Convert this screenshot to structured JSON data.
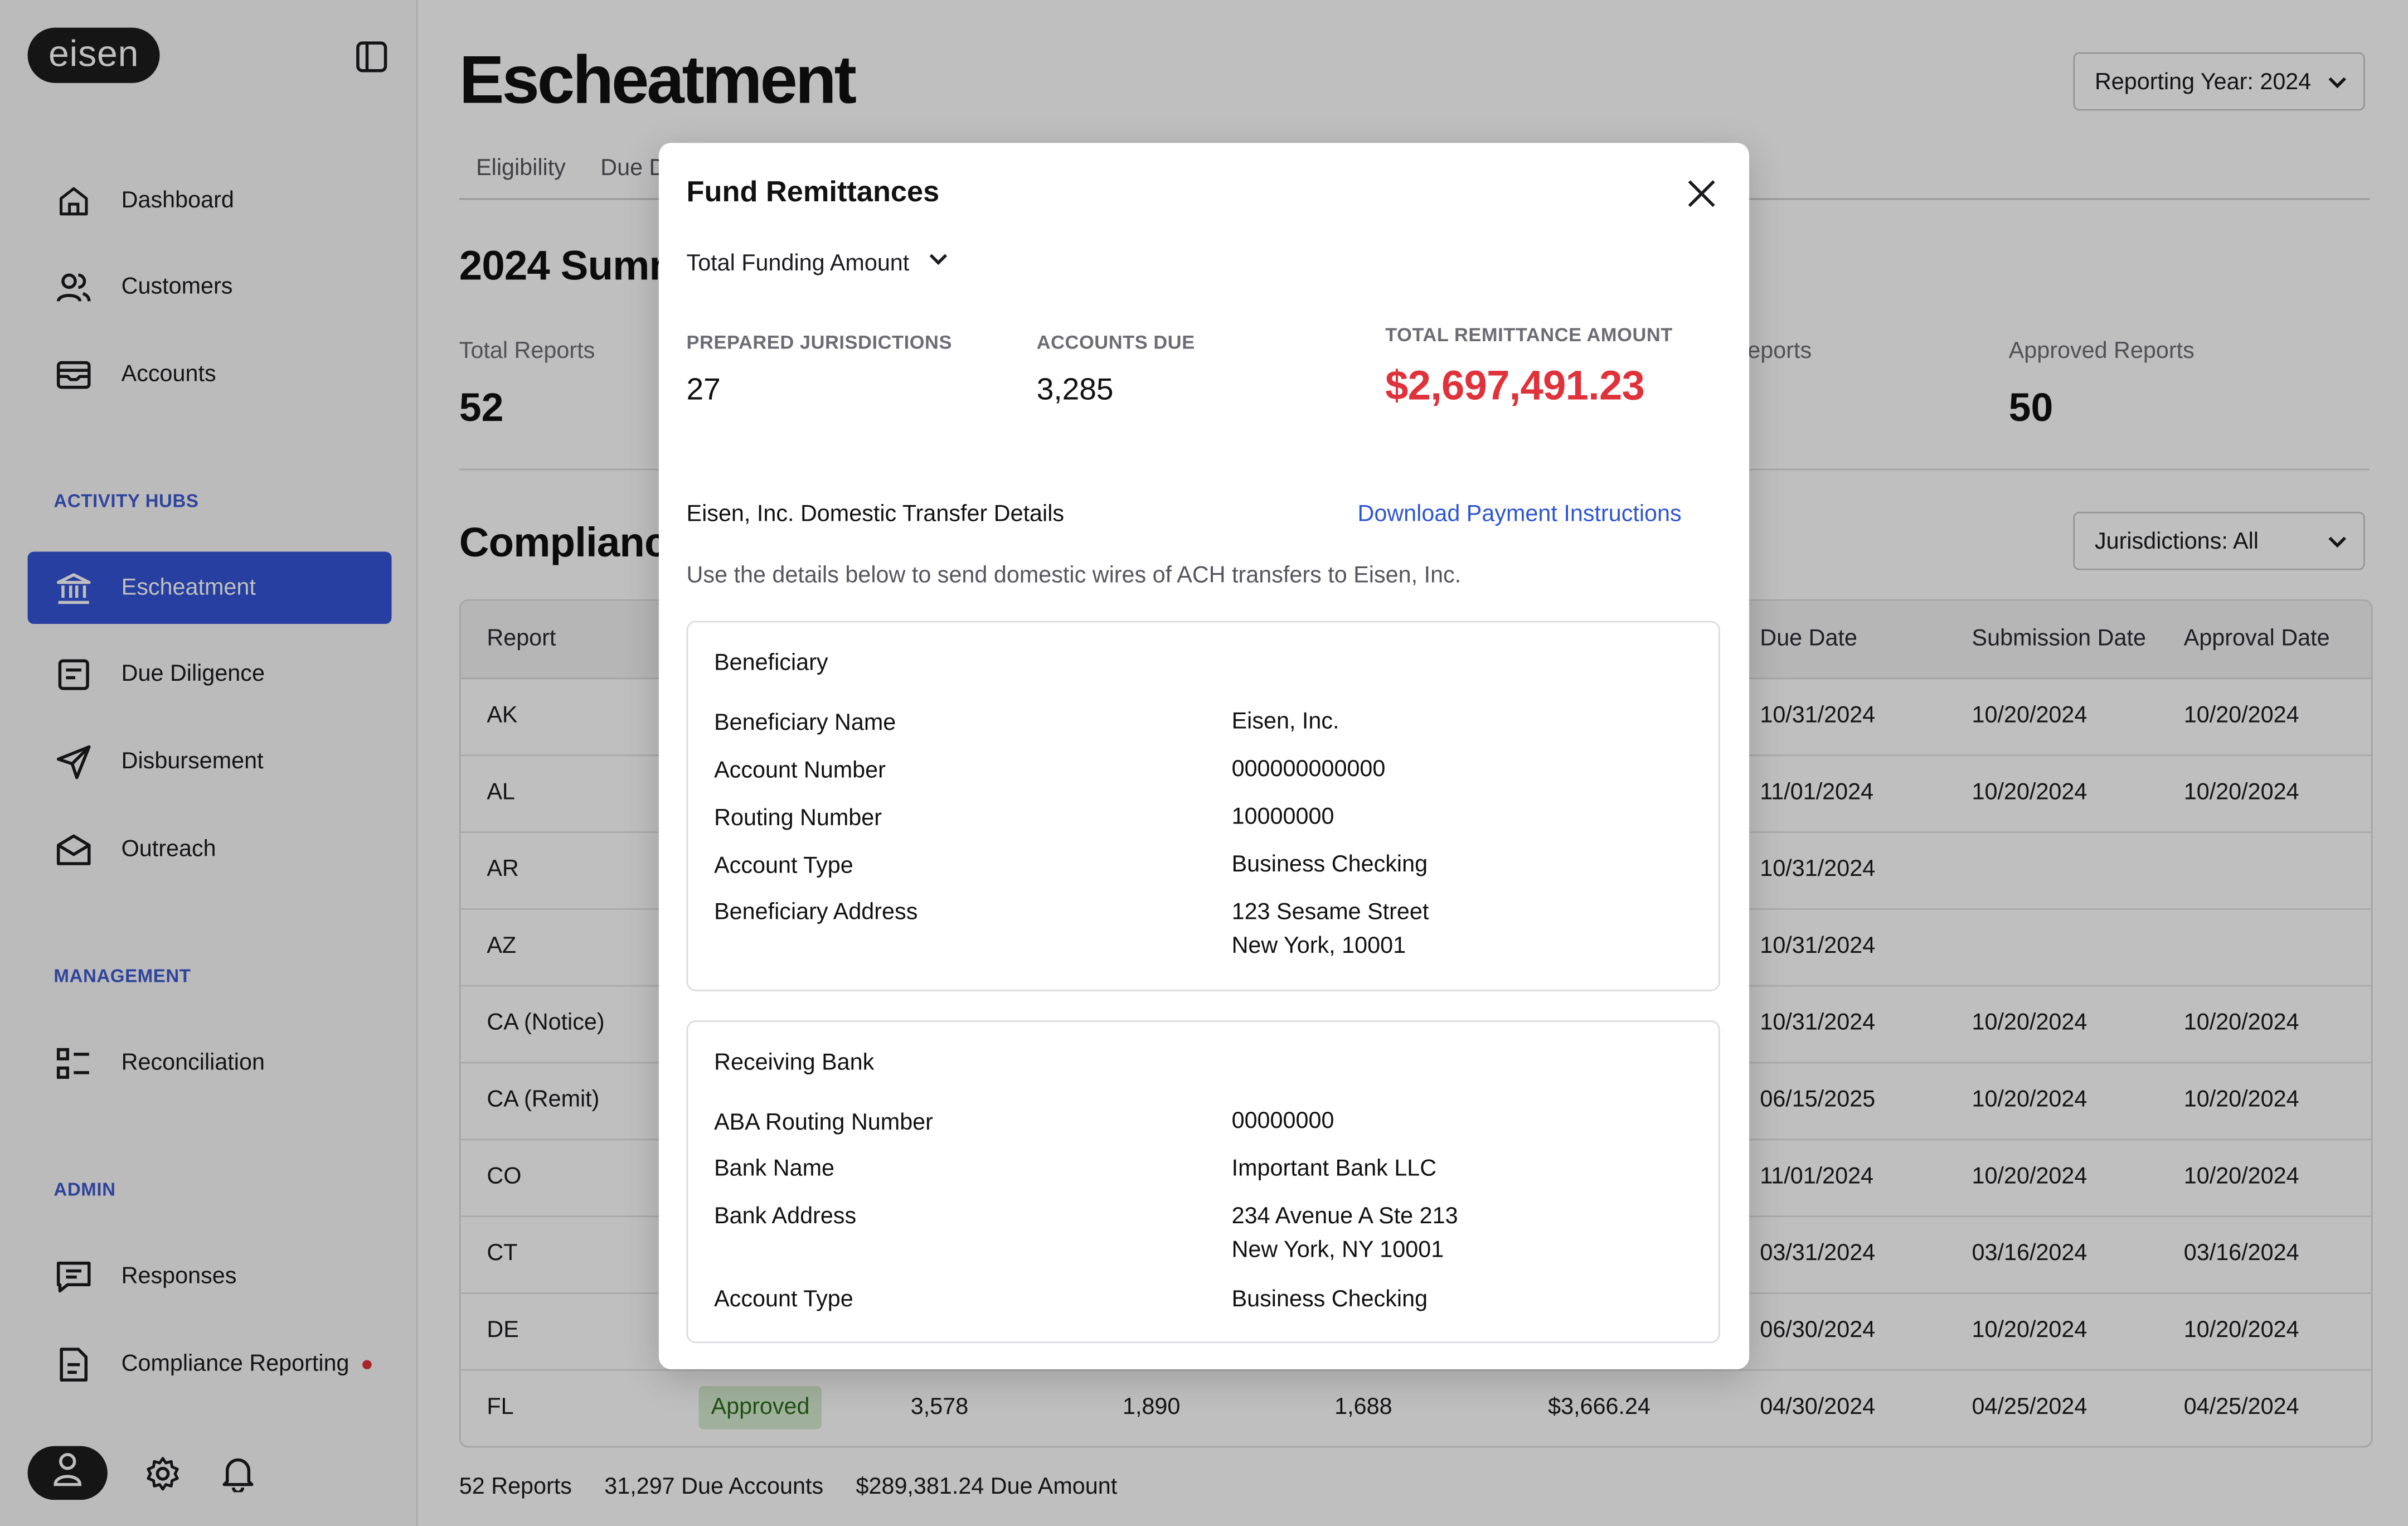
{
  "app": {
    "logo": "eisen",
    "title": "Escheatment"
  },
  "sidebar": {
    "nav": [
      {
        "label": "Dashboard",
        "icon": "home-icon"
      },
      {
        "label": "Customers",
        "icon": "users-icon"
      },
      {
        "label": "Accounts",
        "icon": "wallet-icon"
      }
    ],
    "sections": {
      "activity": "ACTIVITY HUBS",
      "management": "MANAGEMENT",
      "admin": "ADMIN"
    },
    "activity_items": [
      {
        "label": "Escheatment",
        "icon": "bank-icon"
      },
      {
        "label": "Due Diligence",
        "icon": "document-icon"
      },
      {
        "label": "Disbursement",
        "icon": "send-icon"
      },
      {
        "label": "Outreach",
        "icon": "mail-open-icon"
      }
    ],
    "management_items": [
      {
        "label": "Reconciliation",
        "icon": "checklist-icon"
      }
    ],
    "admin_items": [
      {
        "label": "Responses",
        "icon": "chat-icon"
      },
      {
        "label": "Compliance Reporting",
        "icon": "file-icon"
      }
    ]
  },
  "header": {
    "reporting_year": "Reporting Year: 2024"
  },
  "tabs": [
    "Eligibility",
    "Due D"
  ],
  "summary_section": {
    "title": "2024 Summ",
    "stats": [
      {
        "label": "Total Reports",
        "value": "52"
      },
      {
        "label": "eports",
        "value": ""
      },
      {
        "label": "Approved Reports",
        "value": "50"
      }
    ]
  },
  "compliance": {
    "title": "Compliance",
    "jurisdictions": "Jurisdictions: All",
    "columns": {
      "report": "Report",
      "due": "Due Date",
      "submission": "Submission Date",
      "approval": "Approval Date"
    },
    "rows": [
      {
        "report": "AK",
        "due": "10/31/2024",
        "submission": "10/20/2024",
        "approval": "10/20/2024"
      },
      {
        "report": "AL",
        "due": "11/01/2024",
        "submission": "10/20/2024",
        "approval": "10/20/2024"
      },
      {
        "report": "AR",
        "due": "10/31/2024",
        "submission": "",
        "approval": ""
      },
      {
        "report": "AZ",
        "due": "10/31/2024",
        "submission": "",
        "approval": ""
      },
      {
        "report": "CA (Notice)",
        "due": "10/31/2024",
        "submission": "10/20/2024",
        "approval": "10/20/2024"
      },
      {
        "report": "CA (Remit)",
        "due": "06/15/2025",
        "submission": "10/20/2024",
        "approval": "10/20/2024"
      },
      {
        "report": "CO",
        "due": "11/01/2024",
        "submission": "10/20/2024",
        "approval": "10/20/2024"
      },
      {
        "report": "CT",
        "due": "03/31/2024",
        "submission": "03/16/2024",
        "approval": "03/16/2024"
      },
      {
        "report": "DE",
        "due": "06/30/2024",
        "submission": "10/20/2024",
        "approval": "10/20/2024"
      }
    ],
    "last_row": {
      "report": "FL",
      "status": "Approved",
      "c3": "3,578",
      "c4": "1,890",
      "c5": "1,688",
      "c6": "$3,666.24",
      "due": "04/30/2024",
      "submission": "04/25/2024",
      "approval": "04/25/2024"
    },
    "footer": {
      "reports": "52 Reports",
      "accounts": "31,297 Due Accounts",
      "amount": "$289,381.24 Due Amount"
    }
  },
  "modal": {
    "title": "Fund Remittances",
    "dropdown": "Total Funding Amount",
    "stats": {
      "prepared_label": "PREPARED JURISDICTIONS",
      "prepared_value": "27",
      "accounts_label": "ACCOUNTS DUE",
      "accounts_value": "3,285",
      "total_label": "TOTAL REMITTANCE AMOUNT",
      "total_value": "$2,697,491.23"
    },
    "transfer_heading": "Eisen, Inc. Domestic Transfer Details",
    "download_link": "Download Payment Instructions",
    "description": "Use the details below to send domestic wires of ACH transfers to Eisen, Inc.",
    "beneficiary": {
      "title": "Beneficiary",
      "rows": [
        {
          "k": "Beneficiary Name",
          "v": "Eisen, Inc."
        },
        {
          "k": "Account Number",
          "v": "000000000000"
        },
        {
          "k": "Routing Number",
          "v": "10000000"
        },
        {
          "k": "Account Type",
          "v": "Business Checking"
        },
        {
          "k": "Beneficiary Address",
          "v": "123 Sesame Street",
          "v2": "New York, 10001"
        }
      ]
    },
    "receiving_bank": {
      "title": "Receiving Bank",
      "rows": [
        {
          "k": "ABA Routing Number",
          "v": "00000000"
        },
        {
          "k": "Bank Name",
          "v": "Important Bank LLC"
        },
        {
          "k": "Bank Address",
          "v": "234 Avenue A Ste 213",
          "v2": "New York, NY 10001"
        },
        {
          "k": "Account Type",
          "v": "Business Checking"
        }
      ]
    }
  }
}
